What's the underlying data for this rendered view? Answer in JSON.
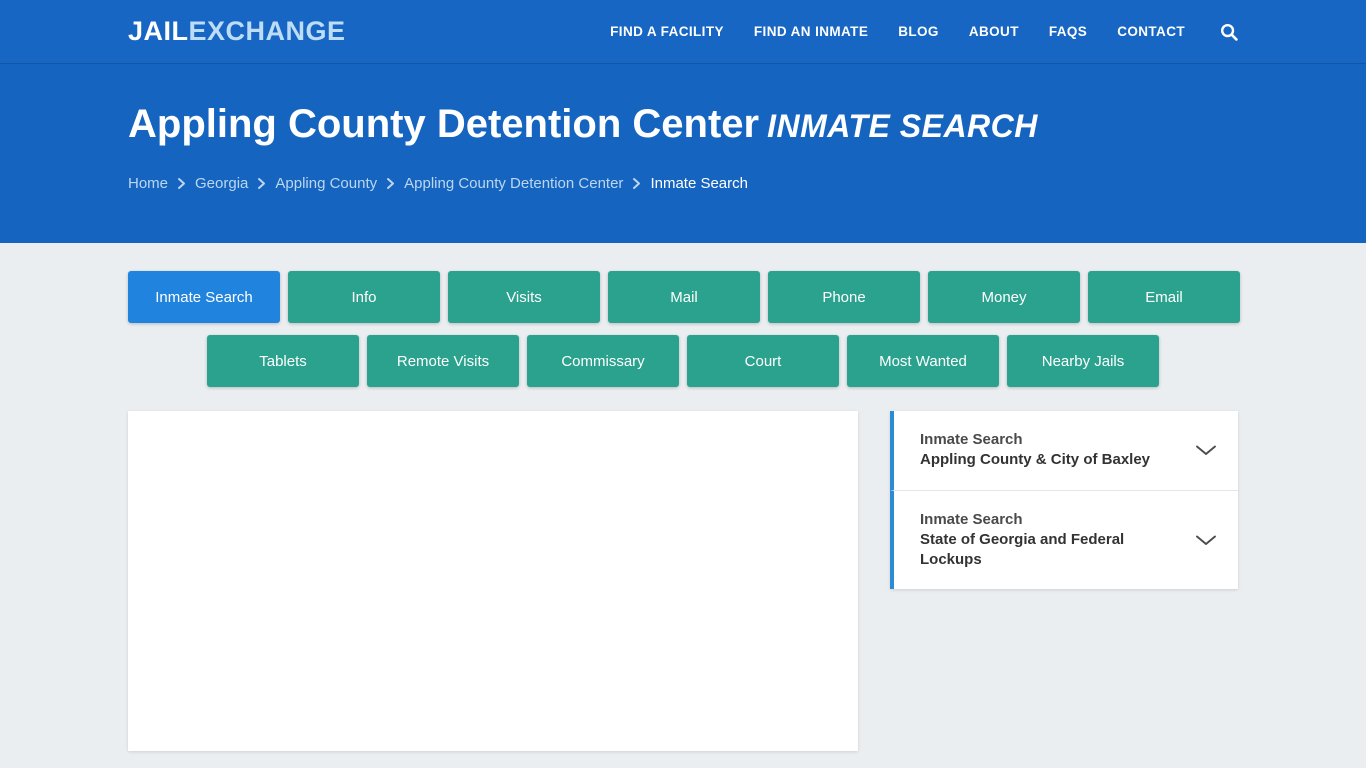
{
  "site": {
    "logo_primary": "JAIL",
    "logo_secondary": "EXCHANGE"
  },
  "nav": {
    "items": [
      {
        "label": "FIND A FACILITY",
        "name": "nav-find-a-facility"
      },
      {
        "label": "FIND AN INMATE",
        "name": "nav-find-an-inmate"
      },
      {
        "label": "BLOG",
        "name": "nav-blog"
      },
      {
        "label": "ABOUT",
        "name": "nav-about"
      },
      {
        "label": "FAQs",
        "name": "nav-faqs"
      },
      {
        "label": "CONTACT",
        "name": "nav-contact"
      }
    ],
    "search_icon": "search-icon"
  },
  "hero": {
    "title": "Appling County Detention Center",
    "subtitle": "INMATE SEARCH",
    "breadcrumb": [
      {
        "label": "Home",
        "current": false
      },
      {
        "label": "Georgia",
        "current": false
      },
      {
        "label": "Appling County",
        "current": false
      },
      {
        "label": "Appling County Detention Center",
        "current": false
      },
      {
        "label": "Inmate Search",
        "current": true
      }
    ],
    "breadcrumb_separator": "›"
  },
  "tabs": {
    "row1": [
      {
        "label": "Inmate Search",
        "active": true
      },
      {
        "label": "Info",
        "active": false
      },
      {
        "label": "Visits",
        "active": false
      },
      {
        "label": "Mail",
        "active": false
      },
      {
        "label": "Phone",
        "active": false
      },
      {
        "label": "Money",
        "active": false
      },
      {
        "label": "Email",
        "active": false
      }
    ],
    "row2": [
      {
        "label": "Tablets",
        "active": false
      },
      {
        "label": "Remote Visits",
        "active": false
      },
      {
        "label": "Commissary",
        "active": false
      },
      {
        "label": "Court",
        "active": false
      },
      {
        "label": "Most Wanted",
        "active": false
      },
      {
        "label": "Nearby Jails",
        "active": false
      }
    ]
  },
  "sidebar": {
    "accordion": [
      {
        "line1": "Inmate Search",
        "line2": "Appling County & City of Baxley",
        "icon": "chevron-down-icon"
      },
      {
        "line1": "Inmate Search",
        "line2": "State of Georgia and Federal Lockups",
        "icon": "chevron-down-icon"
      }
    ]
  },
  "colors": {
    "header_blue": "#1766c4",
    "hero_blue": "#1565c0",
    "tab_teal": "#2aa28d",
    "tab_active_blue": "#2083de",
    "page_background": "#eaeef0",
    "accent_border": "#2b8bd4"
  }
}
